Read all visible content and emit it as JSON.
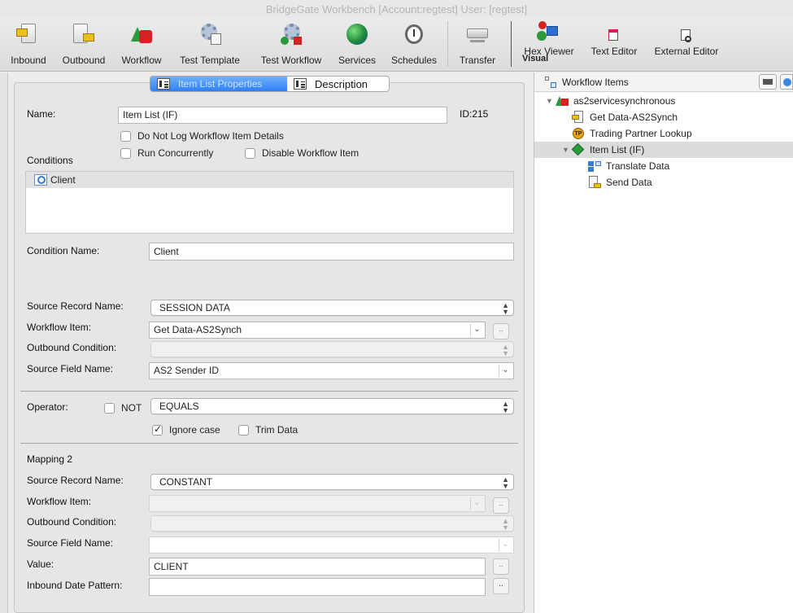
{
  "window": {
    "title": "BridgeGate Workbench [Account:regtest] User: [regtest]"
  },
  "toolbar": {
    "items": [
      {
        "label": "Inbound"
      },
      {
        "label": "Outbound"
      },
      {
        "label": "Workflow"
      },
      {
        "label": "Test Template"
      },
      {
        "label": "Test Workflow"
      },
      {
        "label": "Services"
      },
      {
        "label": "Schedules"
      },
      {
        "label": "Transfer"
      },
      {
        "label": "Hex Viewer"
      },
      {
        "label": "Text Editor"
      },
      {
        "label": "External Editor"
      }
    ],
    "overlay_label": "Visual"
  },
  "tabs": {
    "item_list_properties": "Item List Properties",
    "description": "Description"
  },
  "form": {
    "name_label": "Name:",
    "name_value": "Item List (IF)",
    "id_text": "ID:215",
    "do_not_log": "Do Not Log Workflow Item Details",
    "run_concurrently": "Run Concurrently",
    "disable_item": "Disable Workflow Item",
    "conditions_label": "Conditions",
    "conditions": [
      {
        "name": "Client"
      }
    ],
    "condition_name_label": "Condition Name:",
    "condition_name_value": "Client",
    "mapping1": {
      "source_record_label": "Source Record Name:",
      "source_record_value": "SESSION DATA",
      "workflow_item_label": "Workflow Item:",
      "workflow_item_value": "Get Data-AS2Synch",
      "outbound_condition_label": "Outbound Condition:",
      "outbound_condition_value": "",
      "source_field_label": "Source Field Name:",
      "source_field_value": "AS2 Sender ID"
    },
    "operator_label": "Operator:",
    "not_label": "NOT",
    "operator_value": "EQUALS",
    "ignore_case": "Ignore case",
    "trim_data": "Trim Data",
    "mapping2": {
      "title": "Mapping 2",
      "source_record_label": "Source Record Name:",
      "source_record_value": "CONSTANT",
      "workflow_item_label": "Workflow Item:",
      "workflow_item_value": "",
      "outbound_condition_label": "Outbound Condition:",
      "outbound_condition_value": "",
      "source_field_label": "Source Field Name:",
      "source_field_value": "",
      "value_label": "Value:",
      "value_value": "CLIENT",
      "date_pattern_label": "Inbound Date Pattern:",
      "date_pattern_value": ""
    },
    "browse_label": ".."
  },
  "workflow_items": {
    "title": "Workflow Items",
    "tree": [
      {
        "label": "as2servicesynchronous"
      },
      {
        "label": "Get Data-AS2Synch"
      },
      {
        "label": "Trading Partner Lookup"
      },
      {
        "label": "Item List (IF)"
      },
      {
        "label": "Translate Data"
      },
      {
        "label": "Send Data"
      }
    ]
  },
  "colors": {
    "accent": "#2e7ff5",
    "selected_row": "#dcdcdc"
  }
}
